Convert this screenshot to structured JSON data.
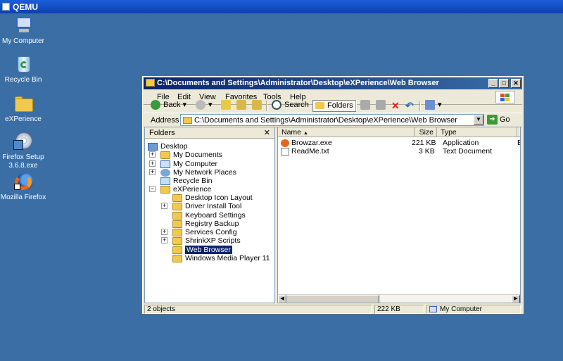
{
  "host": {
    "title": "QEMU"
  },
  "desktop": {
    "icons": [
      {
        "label": "My Computer"
      },
      {
        "label": "Recycle Bin"
      },
      {
        "label": "eXPerience"
      },
      {
        "label": "Firefox Setup 3.6.8.exe"
      },
      {
        "label": "Mozilla Firefox"
      }
    ]
  },
  "window": {
    "title": "C:\\Documents and Settings\\Administrator\\Desktop\\eXPerience\\Web Browser",
    "controls": {
      "minimize": "_",
      "maximize": "□",
      "close": "✕"
    },
    "menu": [
      "File",
      "Edit",
      "View",
      "Favorites",
      "Tools",
      "Help"
    ],
    "toolbar": {
      "back": "Back",
      "search": "Search",
      "folders": "Folders"
    },
    "address": {
      "label": "Address",
      "value": "C:\\Documents and Settings\\Administrator\\Desktop\\eXPerience\\Web Browser",
      "go": "Go"
    },
    "folders_pane": {
      "title": "Folders",
      "close": "✕",
      "tree": [
        {
          "label": "Desktop",
          "expander": ""
        },
        {
          "label": "My Documents",
          "expander": "+"
        },
        {
          "label": "My Computer",
          "expander": "+"
        },
        {
          "label": "My Network Places",
          "expander": "+"
        },
        {
          "label": "Recycle Bin",
          "expander": ""
        },
        {
          "label": "eXPerience",
          "expander": "−"
        },
        {
          "label": "Desktop Icon Layout",
          "expander": ""
        },
        {
          "label": "Driver Install Tool",
          "expander": "+"
        },
        {
          "label": "Keyboard Settings",
          "expander": ""
        },
        {
          "label": "Registry Backup",
          "expander": ""
        },
        {
          "label": "Services Config",
          "expander": "+"
        },
        {
          "label": "ShrinkXP Scripts",
          "expander": "+"
        },
        {
          "label": "Web Browser",
          "expander": "",
          "selected": true
        },
        {
          "label": "Windows Media Player 11",
          "expander": ""
        }
      ]
    },
    "list": {
      "columns": [
        "Name",
        "Size",
        "Type",
        "D"
      ],
      "rows": [
        {
          "name": "Browzar.exe",
          "size": "221 KB",
          "type": "Application",
          "extra": "E"
        },
        {
          "name": "ReadMe.txt",
          "size": "3 KB",
          "type": "Text Document",
          "extra": ""
        }
      ]
    },
    "status": {
      "objects": "2 objects",
      "size": "222 KB",
      "location": "My Computer"
    }
  },
  "colors": {
    "desktop": "#3a6ea5",
    "titlebar": "#0a246a",
    "selection": "#0a246a"
  }
}
